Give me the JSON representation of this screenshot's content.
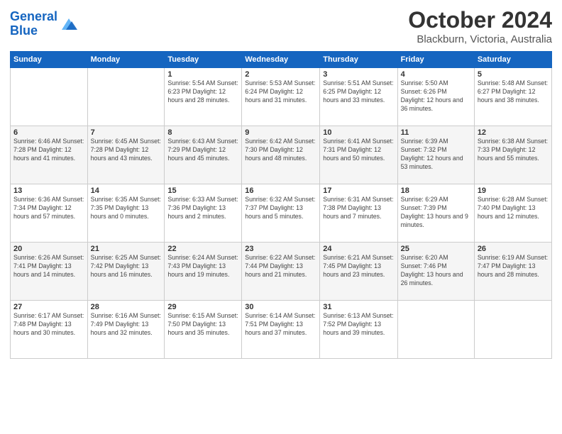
{
  "header": {
    "logo_line1": "General",
    "logo_line2": "Blue",
    "month": "October 2024",
    "location": "Blackburn, Victoria, Australia"
  },
  "days_of_week": [
    "Sunday",
    "Monday",
    "Tuesday",
    "Wednesday",
    "Thursday",
    "Friday",
    "Saturday"
  ],
  "weeks": [
    [
      {
        "day": "",
        "info": ""
      },
      {
        "day": "",
        "info": ""
      },
      {
        "day": "1",
        "info": "Sunrise: 5:54 AM\nSunset: 6:23 PM\nDaylight: 12 hours and 28 minutes."
      },
      {
        "day": "2",
        "info": "Sunrise: 5:53 AM\nSunset: 6:24 PM\nDaylight: 12 hours and 31 minutes."
      },
      {
        "day": "3",
        "info": "Sunrise: 5:51 AM\nSunset: 6:25 PM\nDaylight: 12 hours and 33 minutes."
      },
      {
        "day": "4",
        "info": "Sunrise: 5:50 AM\nSunset: 6:26 PM\nDaylight: 12 hours and 36 minutes."
      },
      {
        "day": "5",
        "info": "Sunrise: 5:48 AM\nSunset: 6:27 PM\nDaylight: 12 hours and 38 minutes."
      }
    ],
    [
      {
        "day": "6",
        "info": "Sunrise: 6:46 AM\nSunset: 7:28 PM\nDaylight: 12 hours and 41 minutes."
      },
      {
        "day": "7",
        "info": "Sunrise: 6:45 AM\nSunset: 7:28 PM\nDaylight: 12 hours and 43 minutes."
      },
      {
        "day": "8",
        "info": "Sunrise: 6:43 AM\nSunset: 7:29 PM\nDaylight: 12 hours and 45 minutes."
      },
      {
        "day": "9",
        "info": "Sunrise: 6:42 AM\nSunset: 7:30 PM\nDaylight: 12 hours and 48 minutes."
      },
      {
        "day": "10",
        "info": "Sunrise: 6:41 AM\nSunset: 7:31 PM\nDaylight: 12 hours and 50 minutes."
      },
      {
        "day": "11",
        "info": "Sunrise: 6:39 AM\nSunset: 7:32 PM\nDaylight: 12 hours and 53 minutes."
      },
      {
        "day": "12",
        "info": "Sunrise: 6:38 AM\nSunset: 7:33 PM\nDaylight: 12 hours and 55 minutes."
      }
    ],
    [
      {
        "day": "13",
        "info": "Sunrise: 6:36 AM\nSunset: 7:34 PM\nDaylight: 12 hours and 57 minutes."
      },
      {
        "day": "14",
        "info": "Sunrise: 6:35 AM\nSunset: 7:35 PM\nDaylight: 13 hours and 0 minutes."
      },
      {
        "day": "15",
        "info": "Sunrise: 6:33 AM\nSunset: 7:36 PM\nDaylight: 13 hours and 2 minutes."
      },
      {
        "day": "16",
        "info": "Sunrise: 6:32 AM\nSunset: 7:37 PM\nDaylight: 13 hours and 5 minutes."
      },
      {
        "day": "17",
        "info": "Sunrise: 6:31 AM\nSunset: 7:38 PM\nDaylight: 13 hours and 7 minutes."
      },
      {
        "day": "18",
        "info": "Sunrise: 6:29 AM\nSunset: 7:39 PM\nDaylight: 13 hours and 9 minutes."
      },
      {
        "day": "19",
        "info": "Sunrise: 6:28 AM\nSunset: 7:40 PM\nDaylight: 13 hours and 12 minutes."
      }
    ],
    [
      {
        "day": "20",
        "info": "Sunrise: 6:26 AM\nSunset: 7:41 PM\nDaylight: 13 hours and 14 minutes."
      },
      {
        "day": "21",
        "info": "Sunrise: 6:25 AM\nSunset: 7:42 PM\nDaylight: 13 hours and 16 minutes."
      },
      {
        "day": "22",
        "info": "Sunrise: 6:24 AM\nSunset: 7:43 PM\nDaylight: 13 hours and 19 minutes."
      },
      {
        "day": "23",
        "info": "Sunrise: 6:22 AM\nSunset: 7:44 PM\nDaylight: 13 hours and 21 minutes."
      },
      {
        "day": "24",
        "info": "Sunrise: 6:21 AM\nSunset: 7:45 PM\nDaylight: 13 hours and 23 minutes."
      },
      {
        "day": "25",
        "info": "Sunrise: 6:20 AM\nSunset: 7:46 PM\nDaylight: 13 hours and 26 minutes."
      },
      {
        "day": "26",
        "info": "Sunrise: 6:19 AM\nSunset: 7:47 PM\nDaylight: 13 hours and 28 minutes."
      }
    ],
    [
      {
        "day": "27",
        "info": "Sunrise: 6:17 AM\nSunset: 7:48 PM\nDaylight: 13 hours and 30 minutes."
      },
      {
        "day": "28",
        "info": "Sunrise: 6:16 AM\nSunset: 7:49 PM\nDaylight: 13 hours and 32 minutes."
      },
      {
        "day": "29",
        "info": "Sunrise: 6:15 AM\nSunset: 7:50 PM\nDaylight: 13 hours and 35 minutes."
      },
      {
        "day": "30",
        "info": "Sunrise: 6:14 AM\nSunset: 7:51 PM\nDaylight: 13 hours and 37 minutes."
      },
      {
        "day": "31",
        "info": "Sunrise: 6:13 AM\nSunset: 7:52 PM\nDaylight: 13 hours and 39 minutes."
      },
      {
        "day": "",
        "info": ""
      },
      {
        "day": "",
        "info": ""
      }
    ]
  ]
}
